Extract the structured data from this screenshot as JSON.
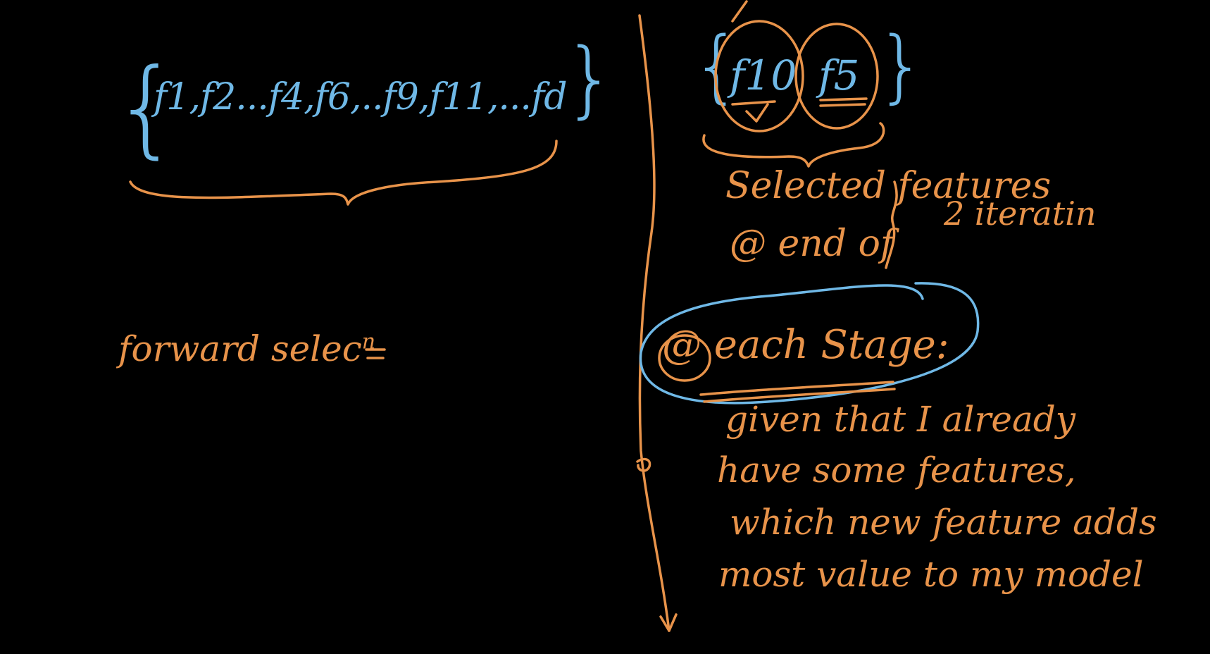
{
  "left": {
    "feature_set": "f1,f2...f4,f6,..f9,f11,...fd",
    "label": "forward selec",
    "label_superscript": "n"
  },
  "right": {
    "selected_f10": "f10",
    "selected_f5": "f5",
    "caption_line1": "Selected features",
    "caption_line2": "@ end of",
    "caption_iterations": "2 iteratin",
    "stage_label": "@ each Stage:",
    "note_line1": "given that I already",
    "note_line2": "have some features,",
    "note_line3": "which new feature adds",
    "note_line4": "most value to my model"
  },
  "colors": {
    "background": "#000000",
    "ink_orange": "#e8934a",
    "ink_blue": "#6fb8e6"
  }
}
